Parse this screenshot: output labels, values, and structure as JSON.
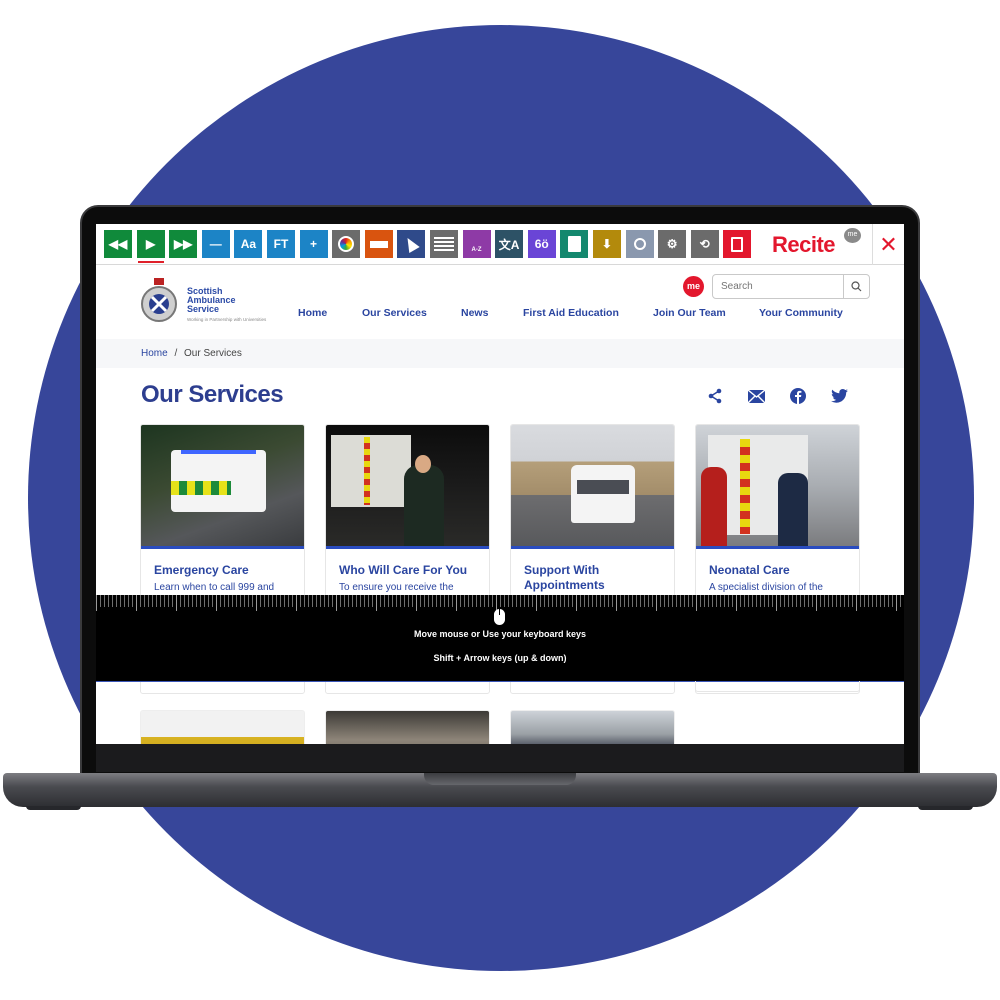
{
  "recite_toolbar": {
    "buttons": [
      {
        "name": "rewind",
        "icon": "rewind-icon",
        "label": "◀◀",
        "color": "#108a3b"
      },
      {
        "name": "play",
        "icon": "play-icon",
        "label": "▶",
        "color": "#108a3b",
        "active": true
      },
      {
        "name": "fast-forward",
        "icon": "fast-forward-icon",
        "label": "▶▶",
        "color": "#108a3b"
      },
      {
        "name": "decrease-text",
        "icon": "minus-icon",
        "label": "—",
        "color": "#1c84c6"
      },
      {
        "name": "font",
        "icon": "font-icon",
        "label": "Aa",
        "color": "#1c84c6"
      },
      {
        "name": "font-type",
        "icon": "font-type-icon",
        "label": "FT",
        "color": "#1c84c6"
      },
      {
        "name": "increase-text",
        "icon": "plus-icon",
        "label": "+",
        "color": "#1c84c6"
      },
      {
        "name": "color-settings",
        "icon": "color-wheel-icon",
        "label": "",
        "color": "#6b6b6b"
      },
      {
        "name": "ruler",
        "icon": "ruler-icon",
        "label": "",
        "color": "#d9540f"
      },
      {
        "name": "cursor",
        "icon": "cursor-icon",
        "label": "",
        "color": "#2f4a8a"
      },
      {
        "name": "screen-mask",
        "icon": "screen-mask-icon",
        "label": "",
        "color": "#6b6b6b"
      },
      {
        "name": "dictionary",
        "icon": "dictionary-icon",
        "label": "A-Z",
        "color": "#8e3aa6"
      },
      {
        "name": "translate",
        "icon": "translate-icon",
        "label": "文A",
        "color": "#2d5266"
      },
      {
        "name": "reading-glasses",
        "icon": "glasses-icon",
        "label": "6ö",
        "color": "#6a45d6"
      },
      {
        "name": "text-only",
        "icon": "document-icon",
        "label": "",
        "color": "#14886e"
      },
      {
        "name": "download",
        "icon": "download-icon",
        "label": "⬇",
        "color": "#b38a0c"
      },
      {
        "name": "magnifier",
        "icon": "magnifier-icon",
        "label": "",
        "color": "#8a98ae"
      },
      {
        "name": "settings",
        "icon": "gear-icon",
        "label": "⚙",
        "color": "#6b6b6b"
      },
      {
        "name": "reset",
        "icon": "reset-icon",
        "label": "⟲",
        "color": "#6b6b6b"
      },
      {
        "name": "user-guide",
        "icon": "user-guide-icon",
        "label": "",
        "color": "#e3172d"
      }
    ],
    "logo": "Recite",
    "logo_badge": "me",
    "close_label": "✕"
  },
  "header": {
    "logo_lines": [
      "Scottish",
      "Ambulance",
      "Service"
    ],
    "logo_tagline": "Working in Partnership with Universities",
    "me_badge": "me",
    "search": {
      "placeholder": "Search",
      "value": ""
    },
    "nav": [
      "Home",
      "Our Services",
      "News",
      "First Aid Education",
      "Join Our Team",
      "Your Community"
    ]
  },
  "breadcrumb": {
    "home": "Home",
    "separator": "/",
    "current": "Our Services"
  },
  "page": {
    "title": "Our Services",
    "share_icons": [
      "share-icon",
      "email-icon",
      "facebook-icon",
      "twitter-icon"
    ]
  },
  "cards": [
    {
      "title": "Emergency Care",
      "desc": "Learn when to call 999 and"
    },
    {
      "title": "Who Will Care For You",
      "desc": "To ensure you receive the"
    },
    {
      "title": "Support With Appointments",
      "desc": ""
    },
    {
      "title": "Neonatal Care",
      "desc": "A specialist division of the"
    }
  ],
  "ruler": {
    "instruction_1": "Move mouse or Use your keyboard keys",
    "instruction_2": "Shift + Arrow keys (up & down)"
  },
  "colors": {
    "brand_blue": "#2a45a0",
    "background_circle": "#37469a",
    "recite_red": "#e3172d"
  }
}
